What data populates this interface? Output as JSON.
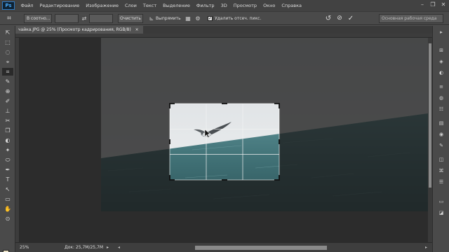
{
  "app": {
    "logo": "Ps"
  },
  "menu": [
    "Файл",
    "Редактирование",
    "Изображение",
    "Слои",
    "Текст",
    "Выделение",
    "Фильтр",
    "3D",
    "Просмотр",
    "Окно",
    "Справка"
  ],
  "window_controls": {
    "minimize": "–",
    "restore": "❐",
    "close": "✕"
  },
  "options": {
    "crop_glyph": "⌗",
    "ratio_value": "В соотно...",
    "width_value": "",
    "height_value": "",
    "swap_glyph": "⇄",
    "clear_label": "Очистить",
    "straighten_glyph": "⊾",
    "straighten_label": "Выпрямить",
    "grid_glyph": "▦",
    "gear_glyph": "⚙",
    "delete_checked": "✓",
    "delete_label": "Удалить отсеч. пикс.",
    "reset_glyph": "↺",
    "cancel_glyph": "⊘",
    "commit_glyph": "✓",
    "workspace_value": "Основная рабочая среда"
  },
  "tools": [
    "⇱",
    "⬚",
    "◌",
    "⌖",
    "⌗",
    "✎",
    "⊕",
    "✐",
    "⊥",
    "✂",
    "❒",
    "◐",
    "✦",
    "⬭",
    "✒",
    "T",
    "↖",
    "▭",
    "✋",
    "⊙"
  ],
  "document": {
    "tab_title": "чайка.JPG @ 25% (Просмотр кадрирования, RGB/8)",
    "tab_close": "×"
  },
  "dock": [
    "▸",
    "⊞",
    "◈",
    "◐",
    "≡",
    "◍",
    "☷",
    "▤",
    "◉",
    "✎",
    "◫",
    "⌘",
    "☰",
    "▭",
    "◪"
  ],
  "status": {
    "zoom": "25%",
    "doc_size": "Док: 25,7M/25,7M",
    "arrow": "▸",
    "scroll_left": "◂",
    "scroll_right": "▸"
  },
  "colors": {
    "accent": "#46a7f7",
    "foreground": "#e9e0c4",
    "background": "#111111"
  }
}
